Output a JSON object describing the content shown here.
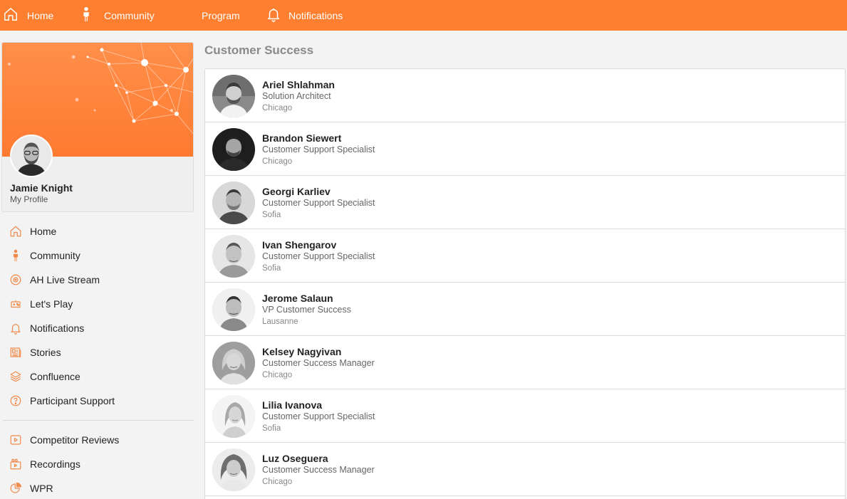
{
  "topnav": {
    "home": "Home",
    "community": "Community",
    "program": "Program",
    "notifications": "Notifications"
  },
  "profile": {
    "name": "Jamie Knight",
    "subtitle": "My Profile"
  },
  "sidebar": {
    "items": [
      {
        "label": "Home",
        "icon": "home-icon"
      },
      {
        "label": "Community",
        "icon": "person-icon"
      },
      {
        "label": "AH Live Stream",
        "icon": "live-stream-icon"
      },
      {
        "label": "Let's Play",
        "icon": "gamepad-icon"
      },
      {
        "label": "Notifications",
        "icon": "bell-icon"
      },
      {
        "label": "Stories",
        "icon": "newspaper-icon"
      },
      {
        "label": "Confluence",
        "icon": "layers-icon"
      },
      {
        "label": "Participant Support",
        "icon": "help-icon"
      }
    ],
    "secondary_items": [
      {
        "label": "Competitor Reviews",
        "icon": "play-icon"
      },
      {
        "label": "Recordings",
        "icon": "video-icon"
      },
      {
        "label": "WPR",
        "icon": "pie-chart-icon"
      }
    ]
  },
  "main": {
    "title": "Customer Success",
    "people": [
      {
        "name": "Ariel Shlahman",
        "title": "Solution Architect",
        "location": "Chicago"
      },
      {
        "name": "Brandon Siewert",
        "title": "Customer Support Specialist",
        "location": "Chicago"
      },
      {
        "name": "Georgi Karliev",
        "title": "Customer Support Specialist",
        "location": "Sofia"
      },
      {
        "name": "Ivan Shengarov",
        "title": "Customer Support Specialist",
        "location": "Sofia"
      },
      {
        "name": "Jerome Salaun",
        "title": "VP Customer Success",
        "location": "Lausanne"
      },
      {
        "name": "Kelsey Nagyivan",
        "title": "Customer Success Manager",
        "location": "Chicago"
      },
      {
        "name": "Lilia Ivanova",
        "title": "Customer Support Specialist",
        "location": "Sofia"
      },
      {
        "name": "Luz Oseguera",
        "title": "Customer Success Manager",
        "location": "Chicago"
      }
    ]
  },
  "colors": {
    "accent": "#ff7f30",
    "icon_accent": "#f08a4b"
  }
}
